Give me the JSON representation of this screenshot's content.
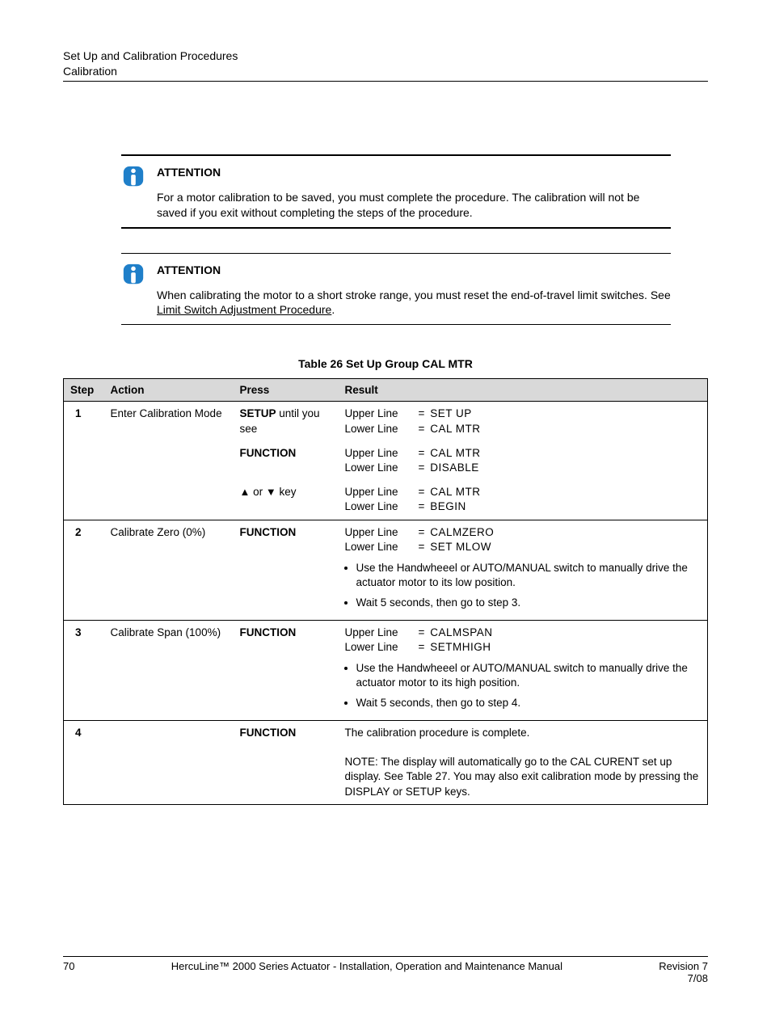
{
  "header": {
    "line1": "Set Up and Calibration Procedures",
    "line2": "Calibration"
  },
  "attention1": {
    "title": "ATTENTION",
    "text": "For a motor calibration to be saved, you must complete the procedure.  The calibration will not be saved if you exit without completing the steps of the procedure."
  },
  "attention2": {
    "title": "ATTENTION",
    "text_before": "When calibrating the motor to a short stroke range, you must reset the end-of-travel limit switches.  See ",
    "link": "Limit Switch Adjustment Procedure",
    "text_after": "."
  },
  "table_title": "Table 26  Set Up Group CAL MTR",
  "columns": {
    "step": "Step",
    "action": "Action",
    "press": "Press",
    "result": "Result"
  },
  "rows": [
    {
      "step": "1",
      "action": "Enter Calibration Mode",
      "sub": [
        {
          "press_pre": "",
          "press_btn": "SETUP",
          "press_post": " until you see",
          "upper": "SET UP",
          "lower": "CAL MTR"
        },
        {
          "press_btn": "FUNCTION",
          "upper": "CAL MTR",
          "lower": "DISABLE"
        },
        {
          "press_arrows": true,
          "press_post": " key",
          "upper": "CAL MTR",
          "lower": "BEGIN"
        }
      ]
    },
    {
      "step": "2",
      "action": "Calibrate Zero (0%)",
      "sub": [
        {
          "press_btn": "FUNCTION",
          "upper": "CALMZERO",
          "lower": "SET MLOW",
          "bullets": [
            "Use the Handwheeel or AUTO/MANUAL switch to manually drive the actuator motor to its low position.",
            "Wait 5 seconds, then go to step 3."
          ]
        }
      ]
    },
    {
      "step": "3",
      "action": "Calibrate Span (100%)",
      "sub": [
        {
          "press_btn": "FUNCTION",
          "upper": "CALMSPAN",
          "lower": "SETMHIGH",
          "bullets": [
            "Use the Handwheeel or AUTO/MANUAL switch to manually drive the actuator motor to its high position.",
            "Wait 5 seconds, then go to step 4."
          ]
        }
      ]
    },
    {
      "step": "4",
      "action": "",
      "sub": [
        {
          "press_btn": "FUNCTION",
          "free_text": "The calibration procedure is complete.",
          "note": "NOTE:  The display will automatically go to the CAL CURENT set up display.  See Table 27.  You may also exit calibration mode by pressing the DISPLAY or SETUP keys."
        }
      ]
    }
  ],
  "footer": {
    "page": "70",
    "title": "HercuLine™ 2000 Series Actuator - Installation, Operation and Maintenance Manual",
    "rev": "Revision 7",
    "date": "7/08"
  }
}
